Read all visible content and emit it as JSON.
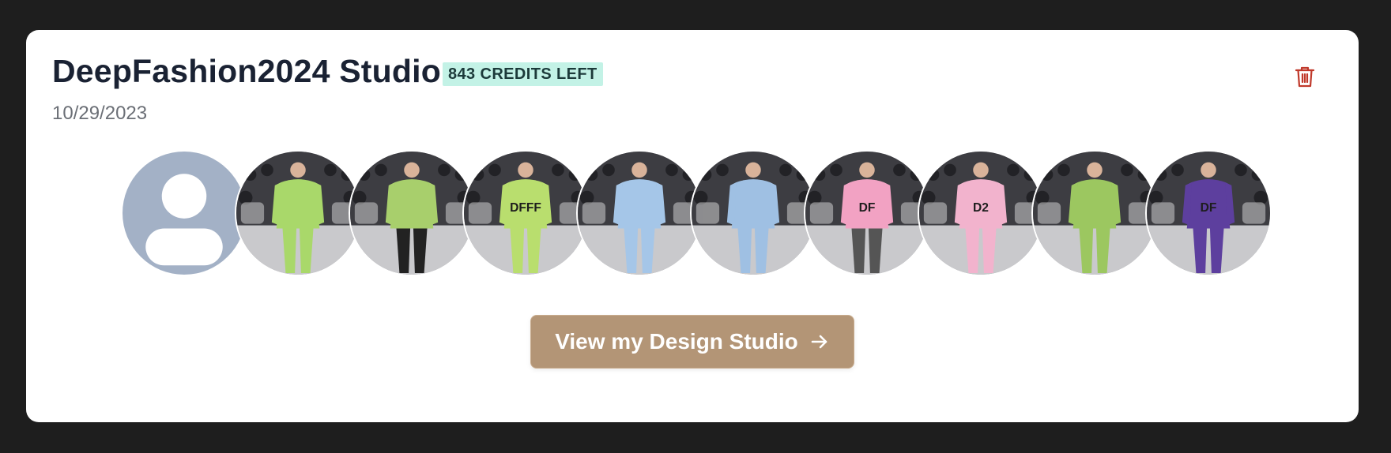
{
  "studio": {
    "title": "DeepFashion2024 Studio",
    "credits_label": "843 CREDITS LEFT",
    "date": "10/29/2023"
  },
  "avatars": [
    {
      "name": "placeholder-avatar",
      "kind": "placeholder",
      "color": "#a3b1c6"
    },
    {
      "name": "look-green-suit",
      "kind": "look",
      "outfit": "#a9d86a",
      "bottom": "#a9d86a",
      "logo": ""
    },
    {
      "name": "look-green-coat",
      "kind": "look",
      "outfit": "#a8cf6c",
      "bottom": "#222222",
      "logo": ""
    },
    {
      "name": "look-green-hoodie",
      "kind": "look",
      "outfit": "#b9de6e",
      "bottom": "#b9de6e",
      "logo": "DFFF"
    },
    {
      "name": "look-blue-dress",
      "kind": "look",
      "outfit": "#a5c6e8",
      "bottom": "#a5c6e8",
      "logo": ""
    },
    {
      "name": "look-blue-jumpsuit",
      "kind": "look",
      "outfit": "#9fc0e3",
      "bottom": "#9fc0e3",
      "logo": ""
    },
    {
      "name": "look-pink-sweater",
      "kind": "look",
      "outfit": "#f2a2c3",
      "bottom": "#555555",
      "logo": "DF"
    },
    {
      "name": "look-pink-grey-jacket",
      "kind": "look",
      "outfit": "#f2b3cd",
      "bottom": "#f2b3cd",
      "logo": "D2"
    },
    {
      "name": "look-green-trench",
      "kind": "look",
      "outfit": "#9cc760",
      "bottom": "#9cc760",
      "logo": ""
    },
    {
      "name": "look-purple-jumpsuit",
      "kind": "look",
      "outfit": "#5d3f9e",
      "bottom": "#5d3f9e",
      "logo": "DF"
    }
  ],
  "cta": {
    "label": "View my Design Studio"
  },
  "colors": {
    "page_bg": "#1e1e1e",
    "card_bg": "#ffffff",
    "badge_bg": "#c3f2e6",
    "button_bg": "#b39576",
    "trash_red": "#c0392b"
  },
  "icons": {
    "trash": "trash-icon",
    "arrow": "arrow-right-icon"
  }
}
